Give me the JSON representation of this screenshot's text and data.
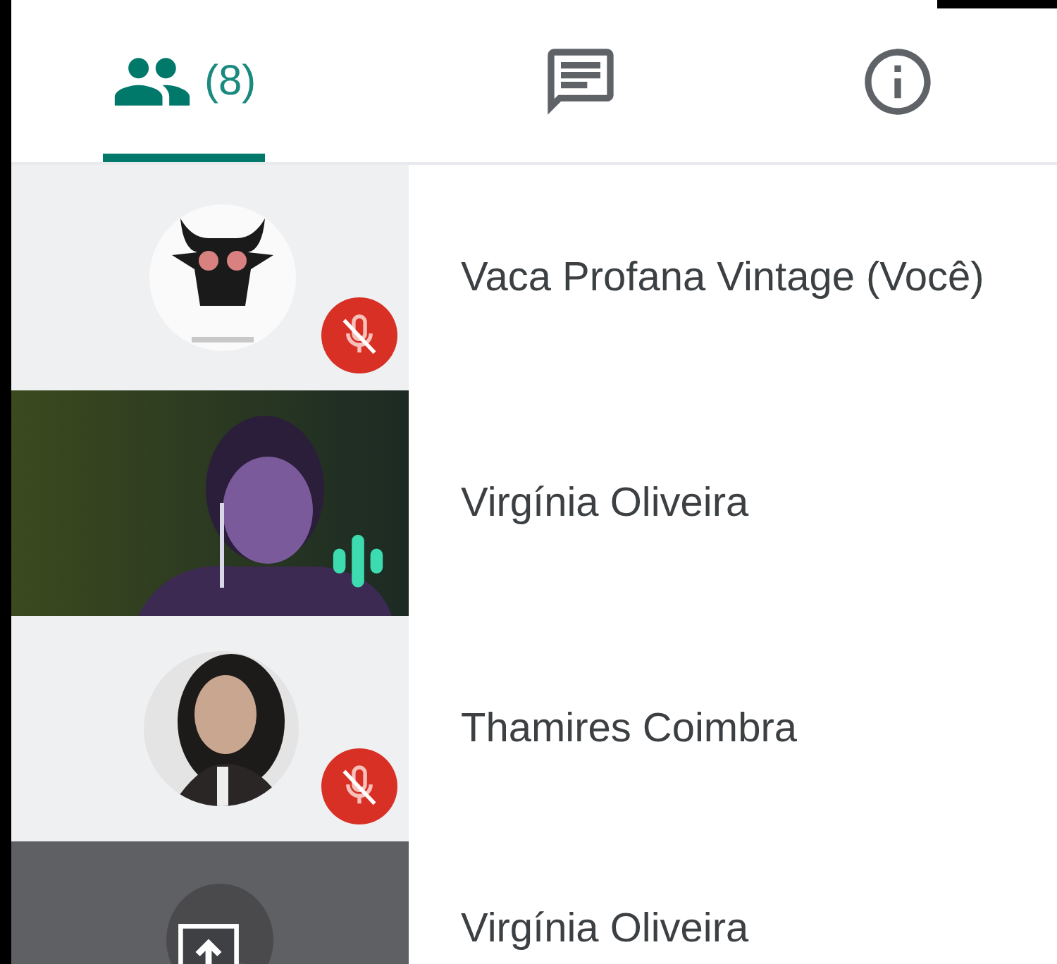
{
  "tabs": [
    {
      "kind": "people",
      "count": "(8)",
      "selected": true
    },
    {
      "kind": "chat",
      "selected": false
    },
    {
      "kind": "info",
      "selected": false
    }
  ],
  "participants": [
    {
      "name": "Vaca Profana Vintage (Você)",
      "kind": "logo",
      "muted": true,
      "speaking": false
    },
    {
      "name": "Virgínia Oliveira",
      "kind": "video",
      "muted": false,
      "speaking": true
    },
    {
      "name": "Thamires Coimbra",
      "kind": "avatar",
      "muted": true,
      "speaking": false
    },
    {
      "name": "Virgínia Oliveira",
      "kind": "screen",
      "muted": false,
      "speaking": false
    }
  ]
}
